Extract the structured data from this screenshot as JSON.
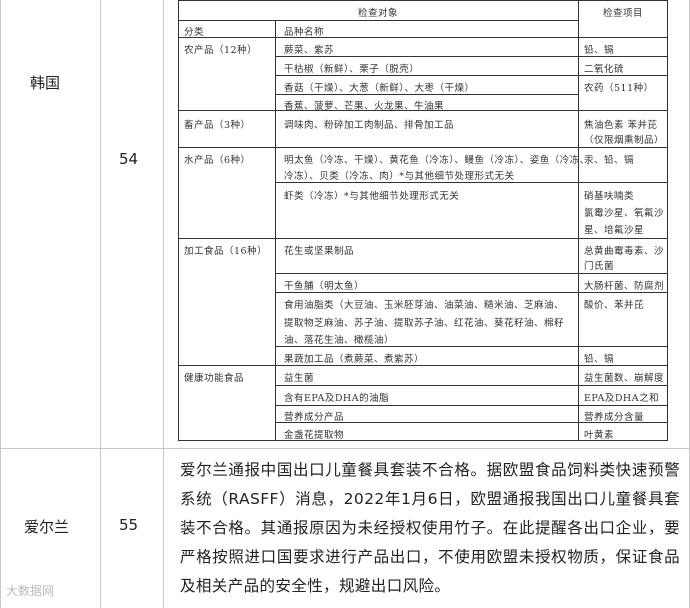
{
  "rows": [
    {
      "country": "韩国",
      "number": "54"
    },
    {
      "country": "爱尔兰",
      "number": "55"
    }
  ],
  "scan_table": {
    "header_left": "检查对象",
    "header_right": "检查项目",
    "sub_col1": "分类",
    "sub_col2": "品种名称",
    "cells": [
      {
        "id": "c1",
        "text": "农产品（12种）"
      },
      {
        "id": "c2",
        "text": "蕨菜、紫苏"
      },
      {
        "id": "c3",
        "text": "铅、镉"
      },
      {
        "id": "c4",
        "text": "干枯椒（新鲜）、栗子（脱壳）"
      },
      {
        "id": "c5",
        "text": "二氧化硫"
      },
      {
        "id": "c6",
        "text": "香菇（干燥）、大葱（新鲜）、大枣（干燥）"
      },
      {
        "id": "c7",
        "text": "农药（511种）"
      },
      {
        "id": "c8",
        "text": "香蕉、菠萝、芒果、火龙果、牛油果"
      },
      {
        "id": "c9",
        "text": "畜产品（3种）"
      },
      {
        "id": "c10",
        "text": "调味肉、粉碎加工肉制品、排骨加工品"
      },
      {
        "id": "c11",
        "text": "焦油色素 苯并芘"
      },
      {
        "id": "c12",
        "text": "（仅限烟熏制品）"
      },
      {
        "id": "c13",
        "text": "水产品（6种）"
      },
      {
        "id": "c14",
        "text": "明太鱼（冷冻、干燥）、黄花鱼（冷冻）、鳗鱼（冷冻）、姿鱼（冷冻、"
      },
      {
        "id": "c15",
        "text": "汞、铅、镉"
      },
      {
        "id": "c16",
        "text": "冷冻）、贝类（冷冻、肉）*与其他细节处理形式无关"
      },
      {
        "id": "c17",
        "text": "虾类（冷冻）*与其他细节处理形式无关"
      },
      {
        "id": "c18",
        "text": "硝基呋喃类"
      },
      {
        "id": "c19",
        "text": "氯霉沙星、氧氟沙"
      },
      {
        "id": "c20",
        "text": "星、培氟沙星"
      },
      {
        "id": "c21",
        "text": "加工食品（16种）"
      },
      {
        "id": "c22",
        "text": "花生或坚果制品"
      },
      {
        "id": "c23",
        "text": "总黄曲霉毒素、沙"
      },
      {
        "id": "c24",
        "text": "门氏菌"
      },
      {
        "id": "c25",
        "text": "干鱼脯（明太鱼）"
      },
      {
        "id": "c26",
        "text": "大肠杆菌、防腐剂"
      },
      {
        "id": "c27",
        "text": "食用油脂类（大豆油、玉米胚芽油、油菜油、糙米油、芝麻油、"
      },
      {
        "id": "c28",
        "text": "酸价、苯并芘"
      },
      {
        "id": "c29",
        "text": "提取物芝麻油、苏子油、提取苏子油、红花油、葵花籽油、棉籽"
      },
      {
        "id": "c30",
        "text": "油、落花生油、橄榄油）"
      },
      {
        "id": "c31",
        "text": "果蔬加工品（煮蕨菜、煮紫苏）"
      },
      {
        "id": "c32",
        "text": "铅、镉"
      },
      {
        "id": "c33",
        "text": "健康功能食品"
      },
      {
        "id": "c34",
        "text": "益生菌"
      },
      {
        "id": "c35",
        "text": "益生菌数、崩解度"
      },
      {
        "id": "c36",
        "text": "含有EPA及DHA的油脂"
      },
      {
        "id": "c37",
        "text": "EPA及DHA之和"
      },
      {
        "id": "c38",
        "text": "营养成分产品"
      },
      {
        "id": "c39",
        "text": "营养成分含量"
      },
      {
        "id": "c40",
        "text": "金盏花提取物"
      },
      {
        "id": "c41",
        "text": "叶黄素"
      }
    ]
  },
  "paragraph": "爱尔兰通报中国出口儿童餐具套装不合格。据欧盟食品饲料类快速预警系统（RASFF）消息，2022年1月6日，欧盟通报我国出口儿童餐具套装不合格。其通报原因为未经授权使用竹子。在此提醒各出口企业，要严格按照进口国要求进行产品出口，不使用欧盟未授权物质，保证食品及相关产品的安全性，规避出口风险。",
  "watermark": "大数据网"
}
